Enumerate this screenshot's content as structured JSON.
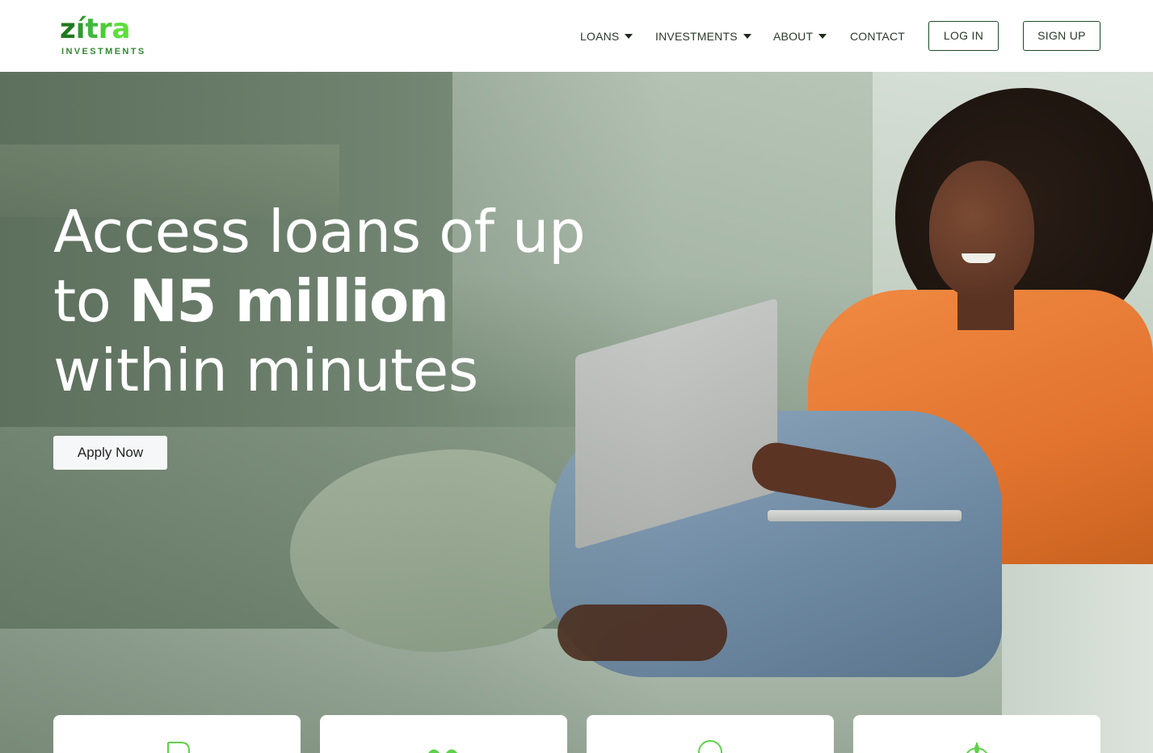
{
  "brand": {
    "name_parts": [
      "z",
      "í",
      "t",
      "r",
      "a"
    ],
    "tagline": "INVESTMENTS",
    "colors": {
      "dark_green": "#1f7a1f",
      "light_green": "#5ee03a"
    }
  },
  "nav": {
    "items": [
      {
        "label": "LOANS",
        "has_dropdown": true
      },
      {
        "label": "INVESTMENTS",
        "has_dropdown": true
      },
      {
        "label": "ABOUT",
        "has_dropdown": true
      },
      {
        "label": "CONTACT",
        "has_dropdown": false
      }
    ],
    "login_label": "LOG IN",
    "signup_label": "SIGN UP"
  },
  "hero": {
    "line1": "Access loans of up",
    "line2_prefix": "to ",
    "line2_bold": "N5 million",
    "line3": "within minutes",
    "cta_label": "Apply Now"
  },
  "cards": [
    {
      "icon": "document-icon"
    },
    {
      "icon": "handshake-icon"
    },
    {
      "icon": "person-icon"
    },
    {
      "icon": "plant-icon"
    }
  ],
  "colors": {
    "icon_green": "#5fd14a",
    "nav_border": "#1f4a2a"
  }
}
